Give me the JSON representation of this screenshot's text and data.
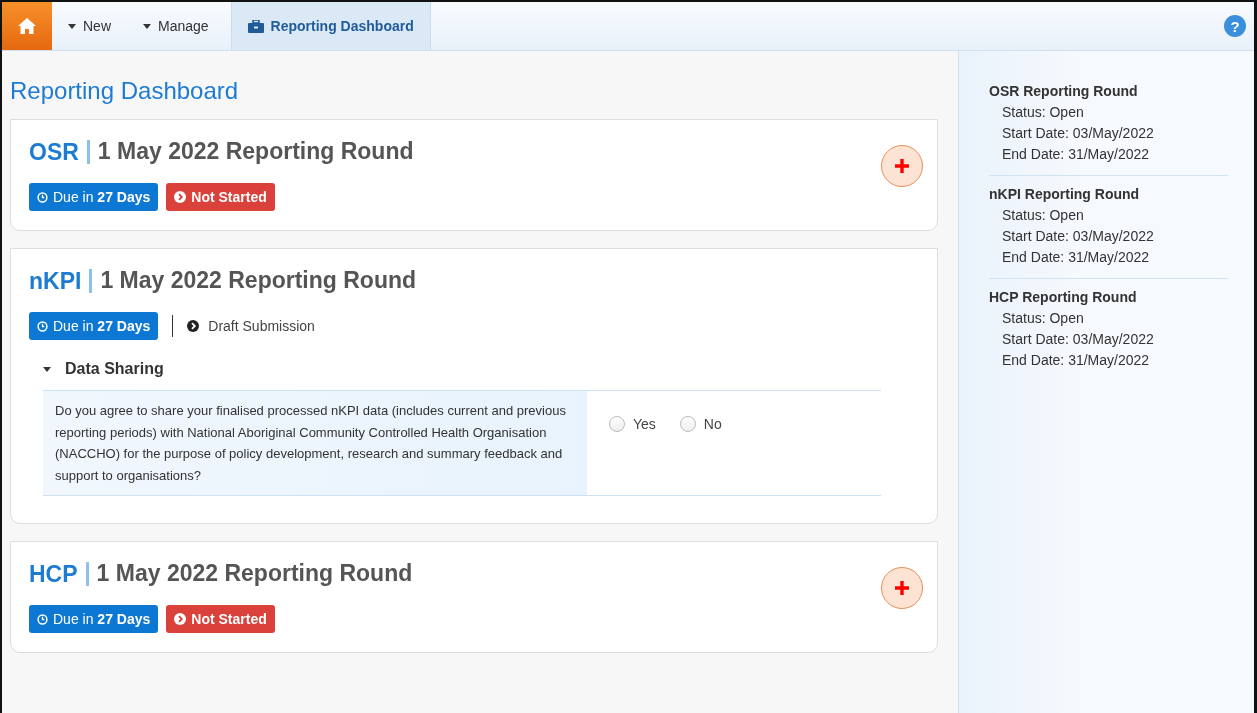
{
  "nav": {
    "items": [
      {
        "label": "New",
        "kind": "menu",
        "selected": false
      },
      {
        "label": "Manage",
        "kind": "menu",
        "selected": false
      },
      {
        "label": "Reporting Dashboard",
        "kind": "tab",
        "selected": true
      }
    ]
  },
  "help": "?",
  "page_title": "Reporting Dashboard",
  "rounds": [
    {
      "code": "OSR",
      "title": "1 May 2022 Reporting Round",
      "due": "Due in **27 Days**",
      "status": {
        "kind": "not-started",
        "label": "Not Started"
      }
    },
    {
      "code": "nKPI",
      "title": "1 May 2022 Reporting Round",
      "due": "Due in **27 Days**",
      "status": {
        "kind": "draft",
        "label": "Draft Submission"
      },
      "section": {
        "title": "Data Sharing",
        "expanded": true,
        "question": "Do you agree to share your finalised processed nKPI data (includes current and previous reporting periods) with National Aboriginal Community Controlled Health Organisation (NACCHO) for the purpose of policy development, research and summary feedback and support to organisations?",
        "options": [
          {
            "label": "Yes",
            "selected": false
          },
          {
            "label": "No",
            "selected": false
          }
        ]
      }
    },
    {
      "code": "HCP",
      "title": "1 May 2022 Reporting Round",
      "due": "Due in **27 Days**",
      "status": {
        "kind": "not-started",
        "label": "Not Started"
      }
    }
  ],
  "sidebar": [
    {
      "title": "OSR Reporting Round",
      "lines": [
        "Status: Open",
        "Start Date: 03/May/2022",
        "End Date: 31/May/2022"
      ]
    },
    {
      "title": "nKPI Reporting Round",
      "lines": [
        "Status: Open",
        "Start Date: 03/May/2022",
        "End Date: 31/May/2022"
      ]
    },
    {
      "title": "HCP Reporting Round",
      "lines": [
        "Status: Open",
        "Start Date: 03/May/2022",
        "End Date: 31/May/2022"
      ]
    }
  ]
}
